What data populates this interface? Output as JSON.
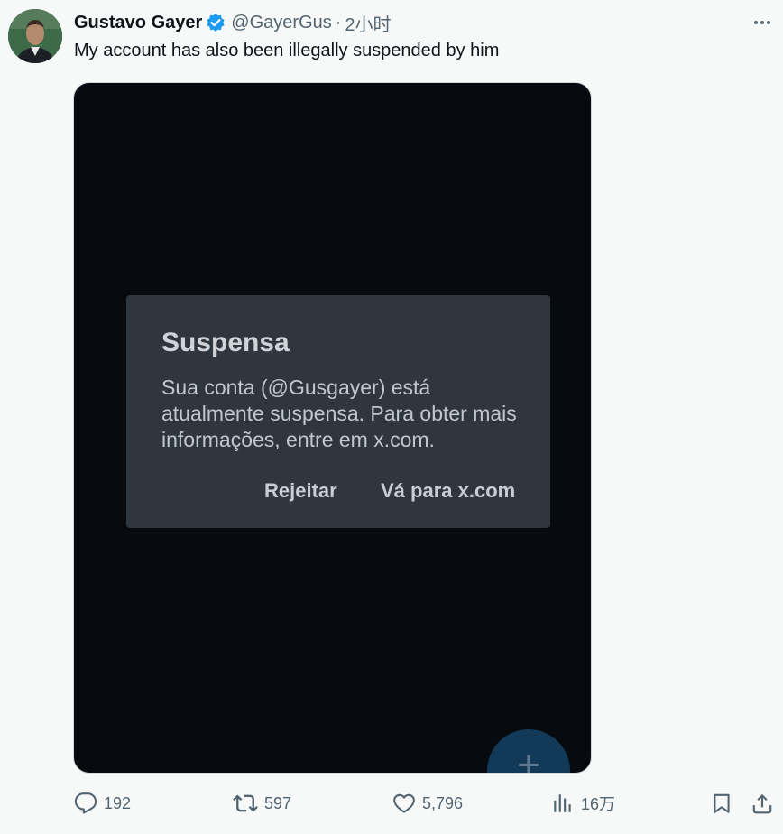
{
  "tweet": {
    "author_name": "Gustavo Gayer",
    "handle": "@GayerGus",
    "separator": "·",
    "time": "2小时",
    "text": "My account has also been illegally suspended by him",
    "verified_color": "#1d9bf0"
  },
  "media": {
    "dialog": {
      "title": "Suspensa",
      "body": "Sua conta (@Gusgayer) está atualmente suspensa. Para obter mais informações, entre em x.com.",
      "reject_label": "Rejeitar",
      "goto_label": "Vá para x.com"
    },
    "fab_label": "+"
  },
  "actions": {
    "replies": "192",
    "retweets": "597",
    "likes": "5,796",
    "views": "16万"
  },
  "icons": {
    "more": "more-icon",
    "reply": "reply-icon",
    "retweet": "retweet-icon",
    "like": "heart-icon",
    "views": "views-icon",
    "bookmark": "bookmark-icon",
    "share": "share-icon",
    "verified": "verified-badge-icon"
  },
  "colors": {
    "background": "#f7f9f9",
    "text_primary": "#0f1419",
    "text_secondary": "#536471",
    "media_background": "#070b0f",
    "dialog_background": "#2f363e",
    "fab_background": "#123a58"
  }
}
